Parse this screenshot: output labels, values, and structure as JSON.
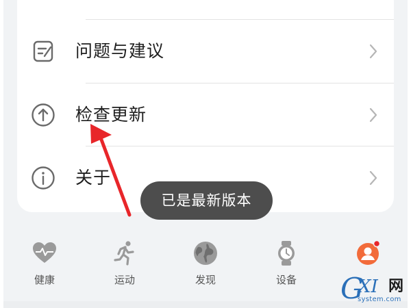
{
  "settings_list": {
    "items": [
      {
        "label": "问题与建议",
        "icon": "feedback-icon"
      },
      {
        "label": "检查更新",
        "icon": "update-icon"
      },
      {
        "label": "关于",
        "icon": "info-icon"
      }
    ]
  },
  "toast": {
    "text": "已是最新版本"
  },
  "bottom_nav": {
    "items": [
      {
        "label": "健康",
        "icon": "heart-icon"
      },
      {
        "label": "运动",
        "icon": "running-icon"
      },
      {
        "label": "发现",
        "icon": "globe-icon"
      },
      {
        "label": "设备",
        "icon": "watch-icon"
      },
      {
        "label": "",
        "icon": "profile-icon",
        "badge": true
      }
    ]
  },
  "watermark": {
    "logo_text": "GXI",
    "site": "system.com",
    "wang": "网"
  },
  "colors": {
    "background": "#f1f3f5",
    "card": "#ffffff",
    "toast": "#4d4d4d",
    "annotation_arrow": "#e8262a",
    "accent": "#f26b3a"
  }
}
